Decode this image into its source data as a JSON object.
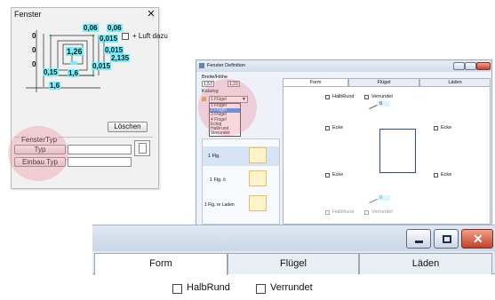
{
  "fenster": {
    "title": "Fenster",
    "close_glyph": "✕",
    "luft_label": "+ Luft dazu",
    "dims": {
      "d1": "0,06",
      "d2": "0,06",
      "d3": "0,015",
      "d4": "1,26",
      "d5": "0,015",
      "d6": "2,135",
      "d7": "0,015",
      "d8": "0,15",
      "d9": "1,6",
      "d10": "1,6",
      "z1": "0",
      "z2": "0",
      "z3": "0"
    },
    "loeschen_label": "Löschen",
    "fenstertyp_label": "FensterTyp",
    "typ_label": "Typ",
    "einbau_typ_label": "Einbau Typ"
  },
  "fenster_definition": {
    "title": "Fenster Definition",
    "breite_hoehe_label": "Breite/Höhe",
    "breite_value": "1,57",
    "hoehe_value": "1,23",
    "katalog_label": "Katalog",
    "dropdown_selected": "1 Flügel",
    "dropdown_options": [
      "1 Flügel",
      "2 Flügel",
      "3 Flügel",
      "4 Flügel",
      "Eckig",
      "Halbrund",
      "Verrundet"
    ],
    "dropdown_highlight_index": 1,
    "list_items": [
      "1 Flg.",
      "1 Flg. li",
      "1 Flg. re Laden"
    ],
    "tabs": [
      "Form",
      "Flügel",
      "Läden"
    ],
    "halbrund_label": "HalbRund",
    "verrundet_label": "Verrundet",
    "ecke_label": "Ecke",
    "value_zero": "0"
  },
  "zoom": {
    "tabs": [
      "Form",
      "Flügel",
      "Läden"
    ],
    "halbrund_label": "HalbRund",
    "verrundet_label": "Verrundet"
  }
}
